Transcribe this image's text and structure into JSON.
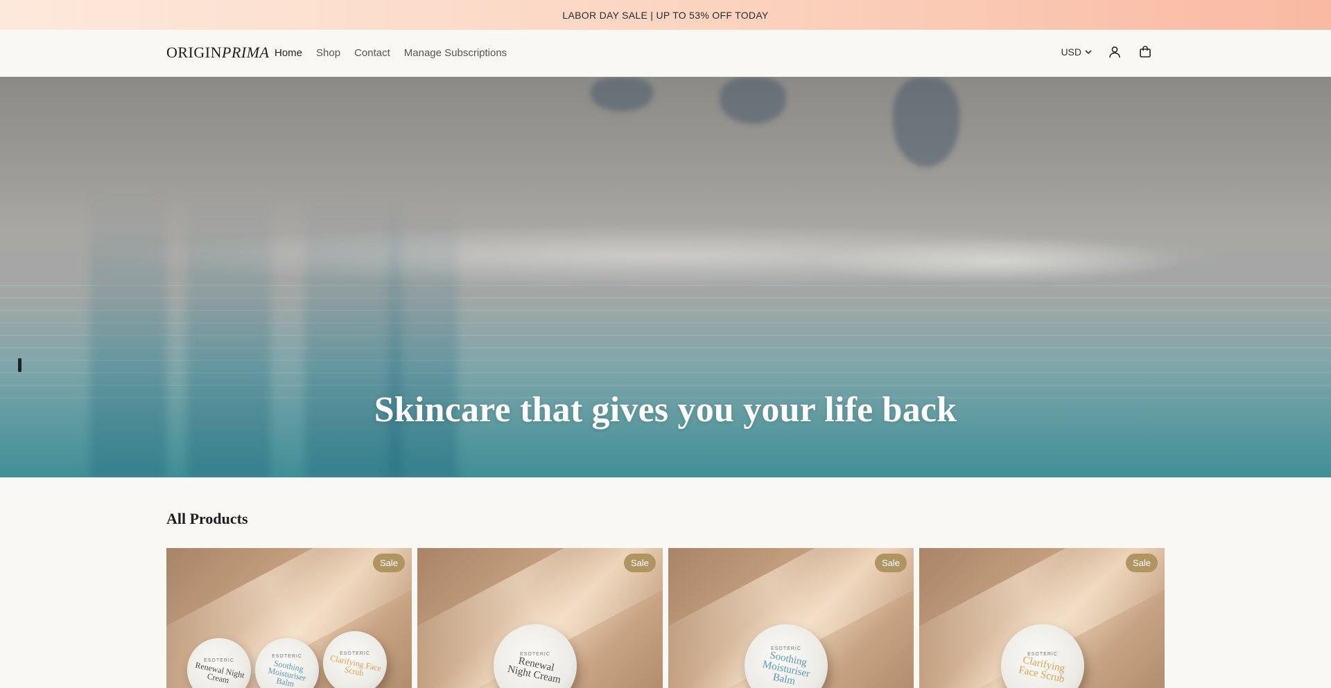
{
  "announcement": {
    "text": "LABOR DAY SALE | UP TO 53% OFF TODAY"
  },
  "header": {
    "logo": {
      "part1": "ORIGIN",
      "part2": "PRIMA"
    },
    "nav": [
      {
        "label": "Home",
        "active": true
      },
      {
        "label": "Shop",
        "active": false
      },
      {
        "label": "Contact",
        "active": false
      },
      {
        "label": "Manage Subscriptions",
        "active": false
      }
    ],
    "currency": "USD",
    "icons": [
      "chevron-down-icon",
      "account-icon",
      "cart-icon"
    ]
  },
  "hero": {
    "title": "Skincare that gives you your life back"
  },
  "products_section": {
    "title": "All Products",
    "badge_label": "Sale",
    "cards": [
      {
        "badge": "Sale",
        "tins": [
          {
            "brand": "ESOTERIC",
            "name": "Renewal Night Cream"
          },
          {
            "brand": "ESOTERIC",
            "name": "Soothing Moisturiser Balm"
          },
          {
            "brand": "ESOTERIC",
            "name": "Clarifying Face Scrub"
          }
        ]
      },
      {
        "badge": "Sale",
        "tins": [
          {
            "brand": "ESOTERIC",
            "name": "Renewal Night Cream"
          }
        ]
      },
      {
        "badge": "Sale",
        "tins": [
          {
            "brand": "ESOTERIC",
            "name": "Soothing Moisturiser Balm"
          }
        ]
      },
      {
        "badge": "Sale",
        "tins": [
          {
            "brand": "ESOTERIC",
            "name": "Clarifying Face Scrub"
          }
        ]
      }
    ]
  },
  "colors": {
    "background": "#faf8f4",
    "announcement_gradient_start": "#fde9dc",
    "announcement_gradient_end": "#f9b9a2",
    "badge": "#b09563",
    "hero_text": "#ffffff"
  }
}
